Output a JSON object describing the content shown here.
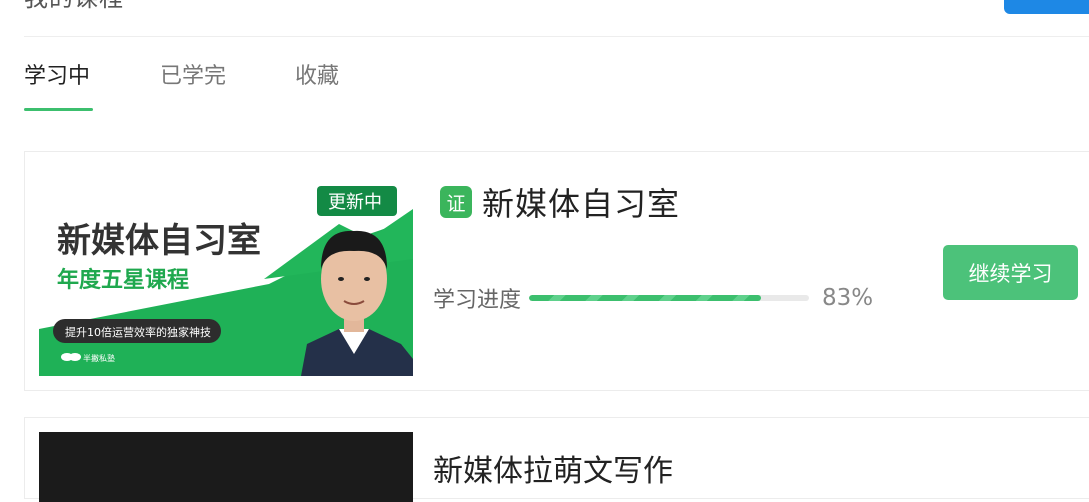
{
  "header": {
    "title": "我的课程"
  },
  "tabs": [
    {
      "label": "学习中",
      "active": true
    },
    {
      "label": "已学完",
      "active": false
    },
    {
      "label": "收藏",
      "active": false
    }
  ],
  "courses": [
    {
      "title": "新媒体自习室",
      "cert_badge": "证",
      "progress_label": "学习进度",
      "progress_percent": 83,
      "progress_text": "83%",
      "action_label": "继续学习",
      "thumbnail": {
        "badge": "更新中",
        "headline": "新媒体自习室",
        "subheadline": "年度五星课程",
        "pill": "提升10倍运营效率的独家神技",
        "brand": "半撇私塾"
      }
    },
    {
      "title": "新媒体拉萌文写作"
    }
  ],
  "colors": {
    "accent_green": "#3cbf6e",
    "button_green": "#4cc27a",
    "thumb_green": "#1fb157",
    "badge_green": "#138a45"
  }
}
